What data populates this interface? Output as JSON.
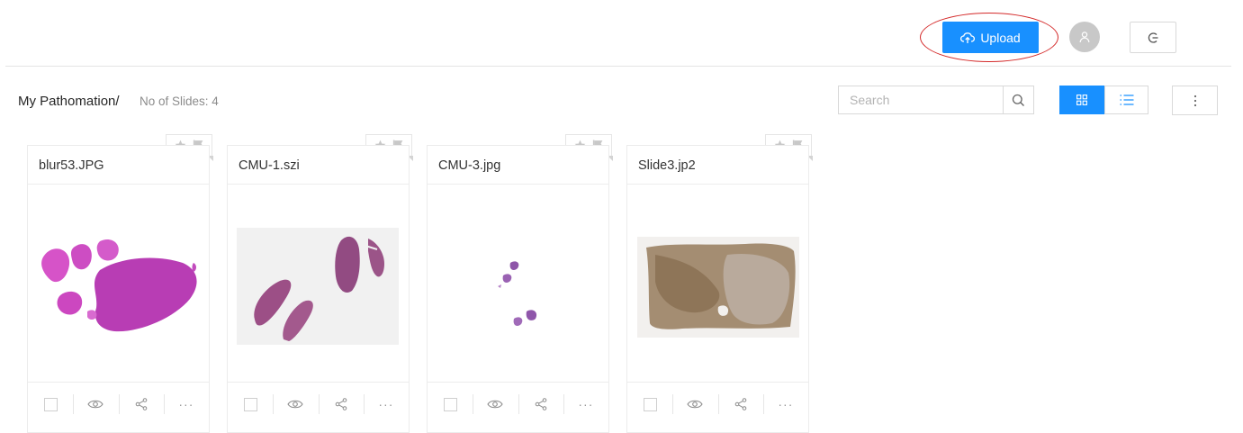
{
  "header": {
    "upload_label": "Upload",
    "upload_icon": "cloud-upload-icon",
    "avatar_icon": "user-icon",
    "logout_icon": "logout-icon",
    "highlight_color": "#d42a2a",
    "accent_color": "#1890ff"
  },
  "toolbar": {
    "breadcrumb": "My Pathomation/",
    "slide_count": "No of Slides: 4",
    "search_placeholder": "Search",
    "search_icon": "search-icon",
    "grid_view_icon": "grid-view-icon",
    "list_view_icon": "list-view-icon",
    "more_icon": "more-vertical-icon",
    "active_view": "grid"
  },
  "slides": [
    {
      "name": "blur53.JPG",
      "thumbnail": "pink-tissue-sections"
    },
    {
      "name": "CMU-1.szi",
      "thumbnail": "purple-tissue-strips"
    },
    {
      "name": "CMU-3.jpg",
      "thumbnail": "small-tissue-fragments"
    },
    {
      "name": "Slide3.jp2",
      "thumbnail": "brown-tissue-section"
    }
  ],
  "card_actions": [
    "select-checkbox",
    "view-icon",
    "share-icon",
    "more-icon"
  ]
}
